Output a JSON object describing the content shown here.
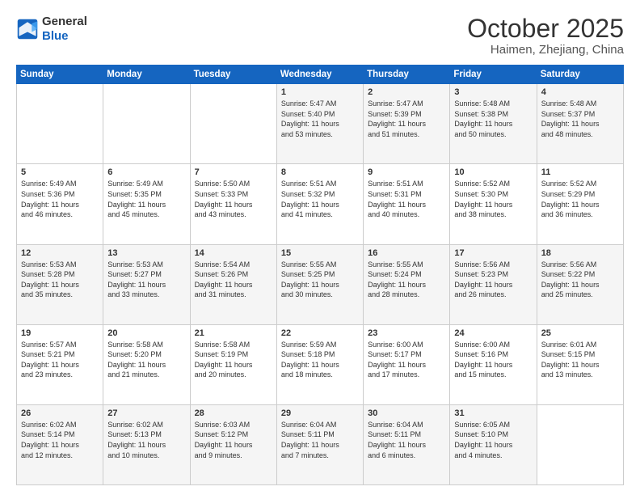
{
  "header": {
    "logo_general": "General",
    "logo_blue": "Blue",
    "month_title": "October 2025",
    "location": "Haimen, Zhejiang, China"
  },
  "days_of_week": [
    "Sunday",
    "Monday",
    "Tuesday",
    "Wednesday",
    "Thursday",
    "Friday",
    "Saturday"
  ],
  "weeks": [
    [
      {
        "day": "",
        "info": ""
      },
      {
        "day": "",
        "info": ""
      },
      {
        "day": "",
        "info": ""
      },
      {
        "day": "1",
        "info": "Sunrise: 5:47 AM\nSunset: 5:40 PM\nDaylight: 11 hours\nand 53 minutes."
      },
      {
        "day": "2",
        "info": "Sunrise: 5:47 AM\nSunset: 5:39 PM\nDaylight: 11 hours\nand 51 minutes."
      },
      {
        "day": "3",
        "info": "Sunrise: 5:48 AM\nSunset: 5:38 PM\nDaylight: 11 hours\nand 50 minutes."
      },
      {
        "day": "4",
        "info": "Sunrise: 5:48 AM\nSunset: 5:37 PM\nDaylight: 11 hours\nand 48 minutes."
      }
    ],
    [
      {
        "day": "5",
        "info": "Sunrise: 5:49 AM\nSunset: 5:36 PM\nDaylight: 11 hours\nand 46 minutes."
      },
      {
        "day": "6",
        "info": "Sunrise: 5:49 AM\nSunset: 5:35 PM\nDaylight: 11 hours\nand 45 minutes."
      },
      {
        "day": "7",
        "info": "Sunrise: 5:50 AM\nSunset: 5:33 PM\nDaylight: 11 hours\nand 43 minutes."
      },
      {
        "day": "8",
        "info": "Sunrise: 5:51 AM\nSunset: 5:32 PM\nDaylight: 11 hours\nand 41 minutes."
      },
      {
        "day": "9",
        "info": "Sunrise: 5:51 AM\nSunset: 5:31 PM\nDaylight: 11 hours\nand 40 minutes."
      },
      {
        "day": "10",
        "info": "Sunrise: 5:52 AM\nSunset: 5:30 PM\nDaylight: 11 hours\nand 38 minutes."
      },
      {
        "day": "11",
        "info": "Sunrise: 5:52 AM\nSunset: 5:29 PM\nDaylight: 11 hours\nand 36 minutes."
      }
    ],
    [
      {
        "day": "12",
        "info": "Sunrise: 5:53 AM\nSunset: 5:28 PM\nDaylight: 11 hours\nand 35 minutes."
      },
      {
        "day": "13",
        "info": "Sunrise: 5:53 AM\nSunset: 5:27 PM\nDaylight: 11 hours\nand 33 minutes."
      },
      {
        "day": "14",
        "info": "Sunrise: 5:54 AM\nSunset: 5:26 PM\nDaylight: 11 hours\nand 31 minutes."
      },
      {
        "day": "15",
        "info": "Sunrise: 5:55 AM\nSunset: 5:25 PM\nDaylight: 11 hours\nand 30 minutes."
      },
      {
        "day": "16",
        "info": "Sunrise: 5:55 AM\nSunset: 5:24 PM\nDaylight: 11 hours\nand 28 minutes."
      },
      {
        "day": "17",
        "info": "Sunrise: 5:56 AM\nSunset: 5:23 PM\nDaylight: 11 hours\nand 26 minutes."
      },
      {
        "day": "18",
        "info": "Sunrise: 5:56 AM\nSunset: 5:22 PM\nDaylight: 11 hours\nand 25 minutes."
      }
    ],
    [
      {
        "day": "19",
        "info": "Sunrise: 5:57 AM\nSunset: 5:21 PM\nDaylight: 11 hours\nand 23 minutes."
      },
      {
        "day": "20",
        "info": "Sunrise: 5:58 AM\nSunset: 5:20 PM\nDaylight: 11 hours\nand 21 minutes."
      },
      {
        "day": "21",
        "info": "Sunrise: 5:58 AM\nSunset: 5:19 PM\nDaylight: 11 hours\nand 20 minutes."
      },
      {
        "day": "22",
        "info": "Sunrise: 5:59 AM\nSunset: 5:18 PM\nDaylight: 11 hours\nand 18 minutes."
      },
      {
        "day": "23",
        "info": "Sunrise: 6:00 AM\nSunset: 5:17 PM\nDaylight: 11 hours\nand 17 minutes."
      },
      {
        "day": "24",
        "info": "Sunrise: 6:00 AM\nSunset: 5:16 PM\nDaylight: 11 hours\nand 15 minutes."
      },
      {
        "day": "25",
        "info": "Sunrise: 6:01 AM\nSunset: 5:15 PM\nDaylight: 11 hours\nand 13 minutes."
      }
    ],
    [
      {
        "day": "26",
        "info": "Sunrise: 6:02 AM\nSunset: 5:14 PM\nDaylight: 11 hours\nand 12 minutes."
      },
      {
        "day": "27",
        "info": "Sunrise: 6:02 AM\nSunset: 5:13 PM\nDaylight: 11 hours\nand 10 minutes."
      },
      {
        "day": "28",
        "info": "Sunrise: 6:03 AM\nSunset: 5:12 PM\nDaylight: 11 hours\nand 9 minutes."
      },
      {
        "day": "29",
        "info": "Sunrise: 6:04 AM\nSunset: 5:11 PM\nDaylight: 11 hours\nand 7 minutes."
      },
      {
        "day": "30",
        "info": "Sunrise: 6:04 AM\nSunset: 5:11 PM\nDaylight: 11 hours\nand 6 minutes."
      },
      {
        "day": "31",
        "info": "Sunrise: 6:05 AM\nSunset: 5:10 PM\nDaylight: 11 hours\nand 4 minutes."
      },
      {
        "day": "",
        "info": ""
      }
    ]
  ]
}
